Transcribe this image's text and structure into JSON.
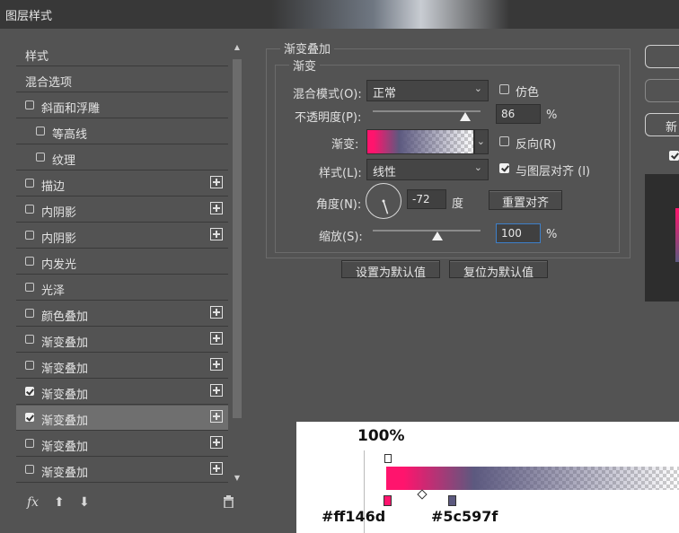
{
  "window": {
    "title": "图层样式"
  },
  "sidebar": {
    "items": [
      {
        "label": "样式",
        "checkbox": false,
        "has_checkbox": false,
        "plus": false,
        "indent": 0
      },
      {
        "label": "混合选项",
        "checkbox": false,
        "has_checkbox": false,
        "plus": false,
        "indent": 0
      },
      {
        "label": "斜面和浮雕",
        "checkbox": false,
        "has_checkbox": true,
        "plus": false,
        "indent": 0
      },
      {
        "label": "等高线",
        "checkbox": false,
        "has_checkbox": true,
        "plus": false,
        "indent": 1
      },
      {
        "label": "纹理",
        "checkbox": false,
        "has_checkbox": true,
        "plus": false,
        "indent": 1
      },
      {
        "label": "描边",
        "checkbox": false,
        "has_checkbox": true,
        "plus": true,
        "indent": 0
      },
      {
        "label": "内阴影",
        "checkbox": false,
        "has_checkbox": true,
        "plus": true,
        "indent": 0
      },
      {
        "label": "内阴影",
        "checkbox": false,
        "has_checkbox": true,
        "plus": true,
        "indent": 0
      },
      {
        "label": "内发光",
        "checkbox": false,
        "has_checkbox": true,
        "plus": false,
        "indent": 0
      },
      {
        "label": "光泽",
        "checkbox": false,
        "has_checkbox": true,
        "plus": false,
        "indent": 0
      },
      {
        "label": "颜色叠加",
        "checkbox": false,
        "has_checkbox": true,
        "plus": true,
        "indent": 0
      },
      {
        "label": "渐变叠加",
        "checkbox": false,
        "has_checkbox": true,
        "plus": true,
        "indent": 0
      },
      {
        "label": "渐变叠加",
        "checkbox": false,
        "has_checkbox": true,
        "plus": true,
        "indent": 0
      },
      {
        "label": "渐变叠加",
        "checkbox": true,
        "has_checkbox": true,
        "plus": true,
        "indent": 0
      },
      {
        "label": "渐变叠加",
        "checkbox": true,
        "has_checkbox": true,
        "plus": true,
        "indent": 0,
        "active": true
      },
      {
        "label": "渐变叠加",
        "checkbox": false,
        "has_checkbox": true,
        "plus": true,
        "indent": 0
      },
      {
        "label": "渐变叠加",
        "checkbox": false,
        "has_checkbox": true,
        "plus": true,
        "indent": 0
      }
    ],
    "footer_icons": [
      "fx-icon",
      "arrow-up-icon",
      "arrow-down-icon",
      "trash-icon"
    ],
    "fx_label": "fx"
  },
  "panel": {
    "group_title": "渐变叠加",
    "subgroup_title": "渐变",
    "blend_mode_label": "混合模式(O):",
    "blend_mode_value": "正常",
    "dither_label": "仿色",
    "dither_checked": false,
    "opacity_label": "不透明度(P):",
    "opacity_value": "86",
    "opacity_unit": "%",
    "opacity_fraction": 0.86,
    "gradient_label": "渐变:",
    "reverse_label": "反向(R)",
    "reverse_checked": false,
    "style_label": "样式(L):",
    "style_value": "线性",
    "align_label": "与图层对齐 (I)",
    "align_checked": true,
    "angle_label": "角度(N):",
    "angle_value": "-72",
    "angle_unit": "度",
    "reset_align_label": "重置对齐",
    "scale_label": "缩放(S):",
    "scale_value": "100",
    "scale_unit": "%",
    "scale_fraction": 0.6,
    "set_default_label": "设置为默认值",
    "reset_default_label": "复位为默认值"
  },
  "right": {
    "new_button_label": "新"
  },
  "annotation": {
    "opacity_stop_label": "100%",
    "color_stop_1": "#ff146d",
    "color_stop_2": "#5c597f"
  },
  "colors": {
    "gradient_start": "#ff146d",
    "gradient_mid": "#5c597f",
    "dialog_bg": "#535353"
  }
}
